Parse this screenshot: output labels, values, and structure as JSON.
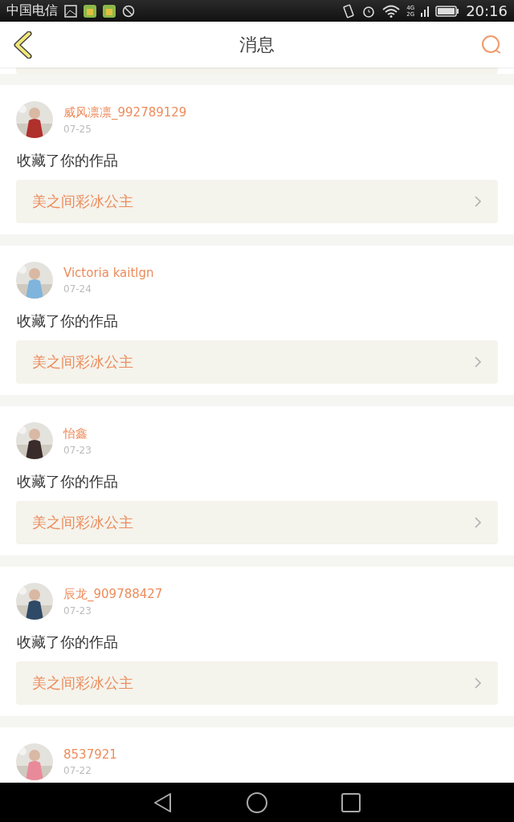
{
  "status_bar": {
    "carrier": "中国电信",
    "network": [
      "4G",
      "2G"
    ],
    "time": "20:16"
  },
  "header": {
    "title": "消息"
  },
  "messages": [
    {
      "name": "威风凛凛_992789129",
      "date": "07-25",
      "action": "收藏了你的作品",
      "work": "美之间彩冰公主"
    },
    {
      "name": "Victoria kaitlgn",
      "date": "07-24",
      "action": "收藏了你的作品",
      "work": "美之间彩冰公主"
    },
    {
      "name": "怡鑫",
      "date": "07-23",
      "action": "收藏了你的作品",
      "work": "美之间彩冰公主"
    },
    {
      "name": "辰龙_909788427",
      "date": "07-23",
      "action": "收藏了你的作品",
      "work": "美之间彩冰公主"
    },
    {
      "name": "8537921",
      "date": "07-22"
    }
  ]
}
